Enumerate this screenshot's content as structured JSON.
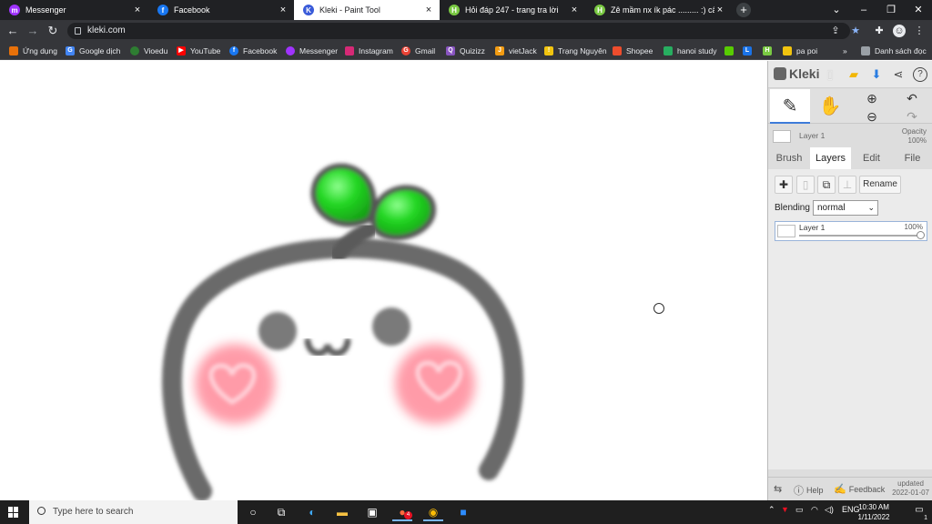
{
  "browser": {
    "tabs": [
      {
        "title": "Messenger",
        "icon": "messenger-icon",
        "color": "#a033ff"
      },
      {
        "title": "Facebook",
        "icon": "facebook-icon",
        "color": "#1877f2"
      },
      {
        "title": "Kleki - Paint Tool",
        "icon": "kleki-icon",
        "color": "#3a5bd9"
      },
      {
        "title": "Hỏi đáp 247 - trang tra lời",
        "icon": "hoidap-icon",
        "color": "#7ac943"
      },
      {
        "title": "Zê mầm nx ík pác ......... :) câu hỏi",
        "icon": "hoidap-icon",
        "color": "#7ac943"
      }
    ],
    "address": "kleki.com",
    "bookmarks": [
      {
        "label": "Ứng dụng",
        "icon": "apps-grid-icon",
        "color": "#e8710a"
      },
      {
        "label": "Google dịch",
        "icon": "translate-icon",
        "color": "#4285f4"
      },
      {
        "label": "Vioedu",
        "icon": "vioedu-icon",
        "color": "#2e7d32"
      },
      {
        "label": "YouTube",
        "icon": "youtube-icon",
        "color": "#ff0000"
      },
      {
        "label": "Facebook",
        "icon": "facebook-icon",
        "color": "#1877f2"
      },
      {
        "label": "Messenger",
        "icon": "messenger-icon",
        "color": "#a033ff"
      },
      {
        "label": "Instagram",
        "icon": "instagram-icon",
        "color": "#d62976"
      },
      {
        "label": "Gmail",
        "icon": "gmail-icon",
        "color": "#ea4335"
      },
      {
        "label": "Quizizz",
        "icon": "quizizz-icon",
        "color": "#8854c0"
      },
      {
        "label": "vietJack",
        "icon": "vietjack-icon",
        "color": "#f39c12"
      },
      {
        "label": "Trạng Nguyên",
        "icon": "trangnguyen-icon",
        "color": "#f1c40f"
      },
      {
        "label": "Shopee",
        "icon": "shopee-icon",
        "color": "#ee4d2d"
      },
      {
        "label": "hanoi study",
        "icon": "hanoistudy-icon",
        "color": "#27ae60"
      },
      {
        "label": "pa poi",
        "icon": "papoi-icon",
        "color": "#f1c40f"
      },
      {
        "label": "Danh sách đọc",
        "icon": "reading-list-icon",
        "color": "#9aa0a6"
      }
    ],
    "more_bookmarks": "»"
  },
  "kleki": {
    "logo": "Kleki",
    "layer_header_name": "Layer 1",
    "opacity_label": "Opacity",
    "opacity_value": "100%",
    "tabs": [
      "Brush",
      "Layers",
      "Edit",
      "File"
    ],
    "rename_label": "Rename",
    "blending_label": "Blending",
    "blending_value": "normal",
    "layer": {
      "name": "Layer 1",
      "opacity": "100%",
      "opacity_fraction": 1.0
    },
    "footer": {
      "help": "Help",
      "feedback": "Feedback",
      "updated_label": "updated",
      "updated_date": "2022-01-07"
    }
  },
  "taskbar": {
    "search_placeholder": "Type here to search",
    "language": "ENG",
    "time": "10:30 AM",
    "date": "1/11/2022",
    "notification_count": "1",
    "chrome_badge": "4"
  },
  "colors": {
    "leaf": "#22d622",
    "outline": "#666666",
    "blush": "#ff9aa8",
    "accent": "#3d7bd9"
  }
}
